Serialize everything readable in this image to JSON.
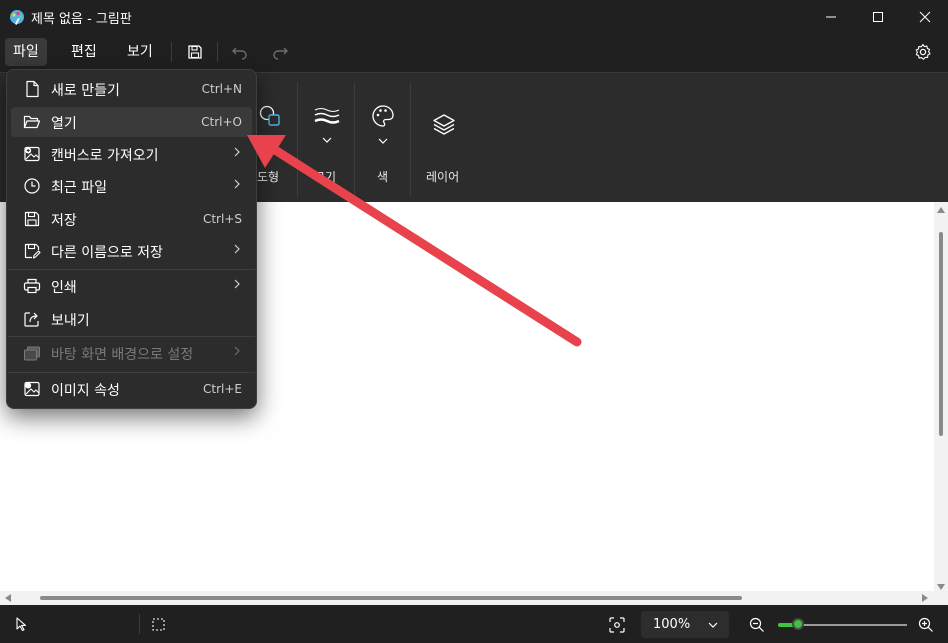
{
  "window": {
    "title": "제목 없음 - 그림판"
  },
  "menubar": {
    "file": "파일",
    "edit": "편집",
    "view": "보기"
  },
  "ribbon": {
    "shapes_label": "도형",
    "size_label": "크기",
    "colors_label": "색",
    "layers_label": "레이어"
  },
  "file_menu": {
    "items": [
      {
        "label": "새로 만들기",
        "shortcut": "Ctrl+N",
        "icon": "new-file-icon"
      },
      {
        "label": "열기",
        "shortcut": "Ctrl+O",
        "icon": "folder-open-icon"
      },
      {
        "label": "캔버스로 가져오기",
        "shortcut": "",
        "icon": "import-image-icon"
      },
      {
        "label": "최근 파일",
        "shortcut": "",
        "icon": "clock-icon"
      },
      {
        "label": "저장",
        "shortcut": "Ctrl+S",
        "icon": "save-icon"
      },
      {
        "label": "다른 이름으로 저장",
        "shortcut": "",
        "icon": "save-as-icon"
      },
      {
        "label": "인쇄",
        "shortcut": "",
        "icon": "print-icon"
      },
      {
        "label": "보내기",
        "shortcut": "",
        "icon": "share-icon"
      },
      {
        "label": "바탕 화면 배경으로 설정",
        "shortcut": "",
        "icon": "wallpaper-icon"
      },
      {
        "label": "이미지 속성",
        "shortcut": "Ctrl+E",
        "icon": "image-properties-icon"
      }
    ]
  },
  "status": {
    "zoom": "100%"
  },
  "colors": {
    "annotation_arrow": "#e8424c",
    "zoom_slider": "#3ec43e"
  }
}
